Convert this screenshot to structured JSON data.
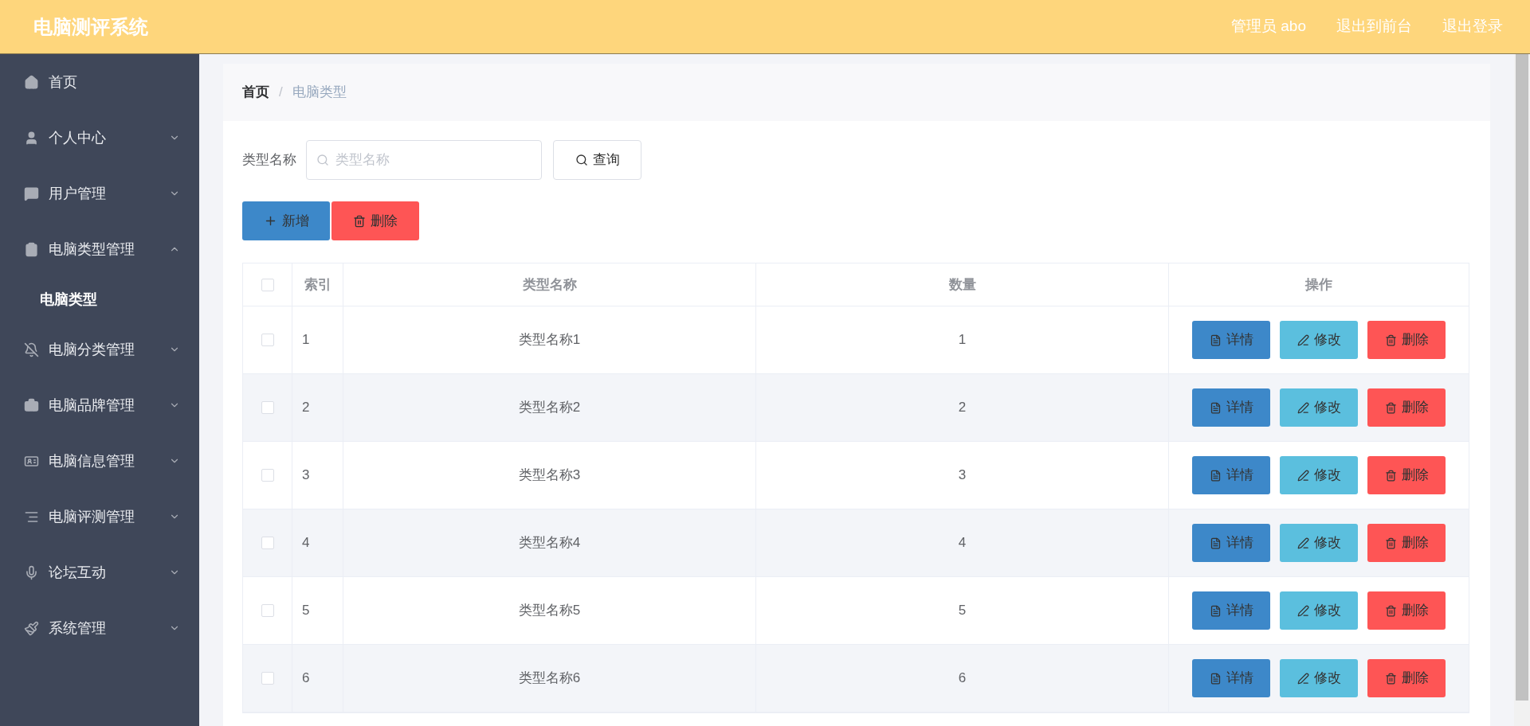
{
  "header": {
    "title": "电脑测评系统",
    "links": [
      "管理员 abo",
      "退出到前台",
      "退出登录"
    ]
  },
  "sidebar": {
    "items": [
      {
        "label": "首页",
        "selected": false
      },
      {
        "label": "个人中心",
        "expanded": false,
        "selected": false
      },
      {
        "label": "用户管理",
        "expanded": false,
        "selected": false
      },
      {
        "label": "电脑类型管理",
        "expanded": true,
        "selected": false,
        "children": [
          {
            "label": "电脑类型",
            "selected": true
          }
        ]
      },
      {
        "label": "电脑分类管理",
        "expanded": false,
        "selected": false
      },
      {
        "label": "电脑品牌管理",
        "expanded": false,
        "selected": false
      },
      {
        "label": "电脑信息管理",
        "expanded": false,
        "selected": false
      },
      {
        "label": "电脑评测管理",
        "expanded": false,
        "selected": false
      },
      {
        "label": "论坛互动",
        "expanded": false,
        "selected": false
      },
      {
        "label": "系统管理",
        "expanded": false,
        "selected": false
      }
    ]
  },
  "breadcrumb": {
    "separator": "/",
    "items": [
      "首页",
      "电脑类型"
    ]
  },
  "search": {
    "label": "类型名称",
    "placeholder": "类型名称",
    "button": "查询"
  },
  "actions": {
    "add": "新增",
    "delete": "删除"
  },
  "table": {
    "select_all_checked": false,
    "columns": [
      "索引",
      "类型名称",
      "数量",
      "操作"
    ],
    "rows": [
      {
        "checked": false,
        "index": "1",
        "name": "类型名称1",
        "count": "1",
        "buttons": [
          "详情",
          "修改",
          "删除"
        ]
      },
      {
        "checked": false,
        "index": "2",
        "name": "类型名称2",
        "count": "2",
        "buttons": [
          "详情",
          "修改",
          "删除"
        ]
      },
      {
        "checked": false,
        "index": "3",
        "name": "类型名称3",
        "count": "3",
        "buttons": [
          "详情",
          "修改",
          "删除"
        ]
      },
      {
        "checked": false,
        "index": "4",
        "name": "类型名称4",
        "count": "4",
        "buttons": [
          "详情",
          "修改",
          "删除"
        ]
      },
      {
        "checked": false,
        "index": "5",
        "name": "类型名称5",
        "count": "5",
        "buttons": [
          "详情",
          "修改",
          "删除"
        ]
      },
      {
        "checked": false,
        "index": "6",
        "name": "类型名称6",
        "count": "6",
        "buttons": [
          "详情",
          "修改",
          "删除"
        ]
      }
    ]
  }
}
